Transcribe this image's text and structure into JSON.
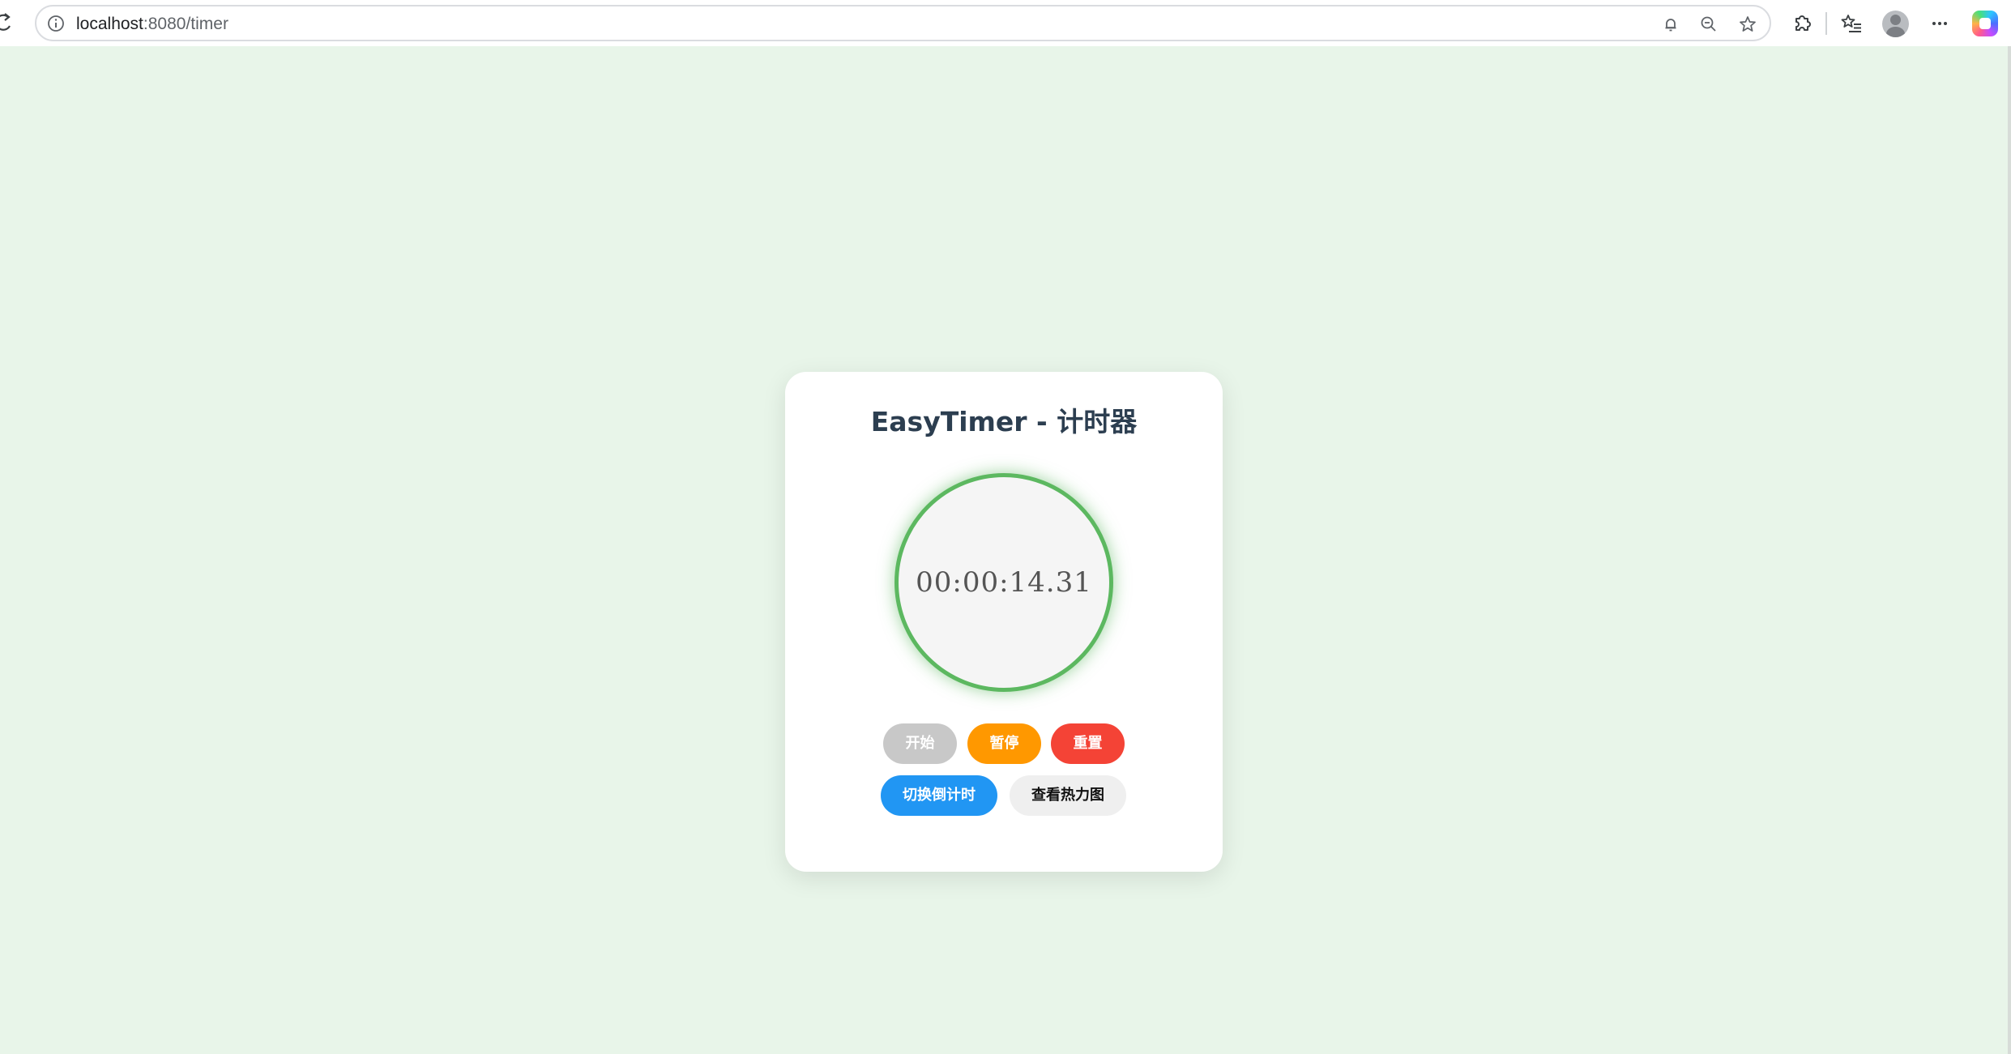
{
  "browser": {
    "url_host": "localhost",
    "url_rest": ":8080/timer"
  },
  "app": {
    "title": "EasyTimer - 计时器",
    "time_display": "00:00:14.31",
    "buttons": {
      "start": "开始",
      "pause": "暂停",
      "reset": "重置",
      "toggle_countdown": "切换倒计时",
      "view_heatmap": "查看热力图"
    }
  },
  "colors": {
    "page_background": "#e8f5e9",
    "dial_ring": "#5cb860",
    "start_disabled": "#c8c8c8",
    "pause": "#ff9800",
    "reset": "#f44336",
    "toggle": "#2196f3",
    "heatmap": "#efefef",
    "title": "#2c3e50"
  },
  "icons": {
    "reload": "reload-icon",
    "site_info": "info-icon",
    "notifications": "bell-icon",
    "zoom": "zoom-out-icon",
    "favorite": "star-icon",
    "extensions": "puzzle-icon",
    "favorites_list": "favorites-icon",
    "profile": "avatar",
    "more": "more-icon",
    "copilot": "copilot-icon"
  }
}
